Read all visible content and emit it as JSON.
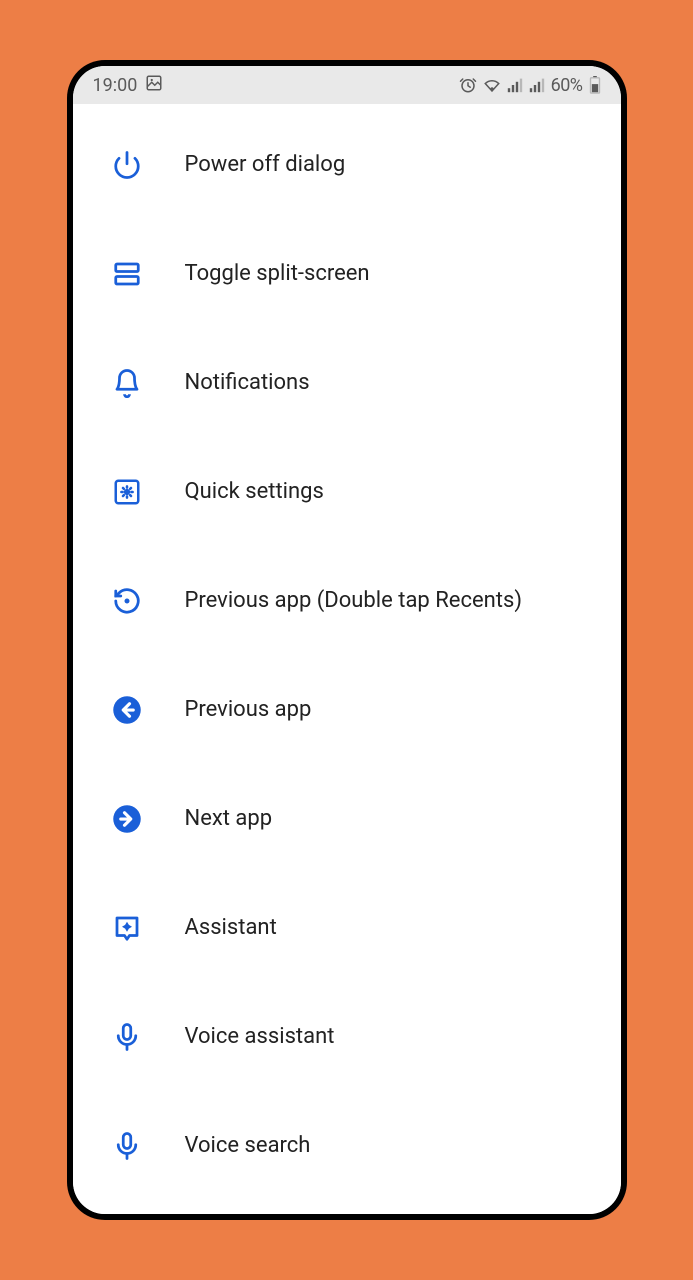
{
  "statusbar": {
    "time": "19:00",
    "battery": "60%"
  },
  "menu": [
    {
      "id": "power-off",
      "label": "Power off dialog"
    },
    {
      "id": "split-screen",
      "label": "Toggle split-screen"
    },
    {
      "id": "notifications",
      "label": "Notifications"
    },
    {
      "id": "quick-settings",
      "label": "Quick settings"
    },
    {
      "id": "previous-app-double",
      "label": "Previous app (Double tap Recents)"
    },
    {
      "id": "previous-app",
      "label": "Previous app"
    },
    {
      "id": "next-app",
      "label": "Next app"
    },
    {
      "id": "assistant",
      "label": "Assistant"
    },
    {
      "id": "voice-assistant",
      "label": "Voice assistant"
    },
    {
      "id": "voice-search",
      "label": "Voice search"
    }
  ],
  "colors": {
    "accent": "#1a5fd8",
    "background": "#ed7e46"
  }
}
